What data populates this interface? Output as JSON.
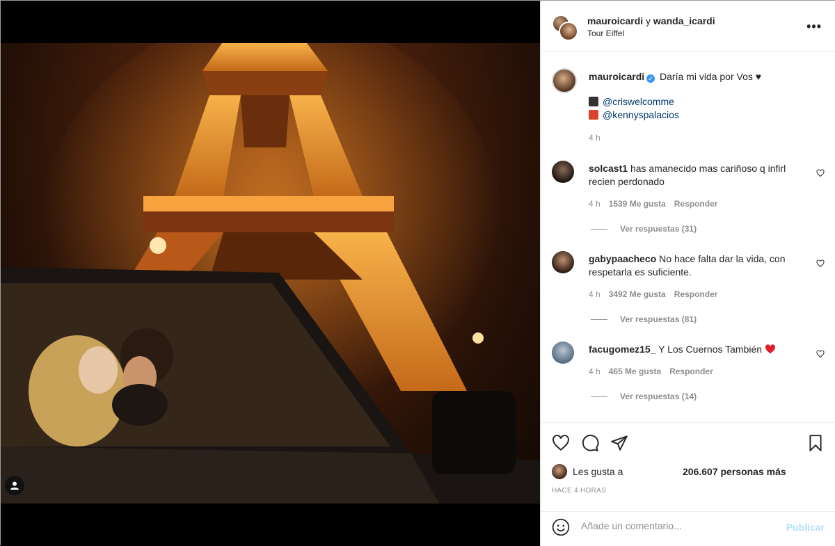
{
  "post": {
    "header": {
      "user1": "mauroicardi",
      "conj": "y",
      "user2": "wanda_icardi",
      "location": "Tour Eiffel"
    },
    "caption": {
      "username": "mauroicardi",
      "text": "Daría mi vida por Vos",
      "heart": "♥",
      "mention1": "@criswelcomme",
      "mention2": "@kennyspalacios",
      "time": "4 h"
    },
    "comments": [
      {
        "username": "solcast1",
        "text": "has amanecido mas cariñoso q infirl recien perdonado",
        "time": "4 h",
        "likes": "1539 Me gusta",
        "reply": "Responder",
        "replies": "Ver respuestas (31)"
      },
      {
        "username": "gabypaacheco",
        "text": "No hace falta dar la vida, con respetarla es suficiente.",
        "time": "4 h",
        "likes": "3492 Me gusta",
        "reply": "Responder",
        "replies": "Ver respuestas (81)"
      },
      {
        "username": "facugomez15_",
        "text": "Y Los Cuernos También",
        "time": "4 h",
        "likes": "465 Me gusta",
        "reply": "Responder",
        "replies": "Ver respuestas (14)"
      }
    ],
    "likes": {
      "label": "Les gusta a",
      "count": "206.607 personas más"
    },
    "ago": "HACE 4 HORAS",
    "add_comment": {
      "placeholder": "Añade un comentario...",
      "publish": "Publicar"
    },
    "icons": [
      "heart-icon",
      "comment-icon",
      "share-icon",
      "bookmark-icon",
      "more-icon",
      "smile-icon",
      "user-tag-icon",
      "verified-icon"
    ],
    "colors": {
      "link": "#00376b",
      "verified": "#3897f0",
      "publish_disabled": "#b2dffc",
      "muted": "#8e8e8e"
    }
  }
}
